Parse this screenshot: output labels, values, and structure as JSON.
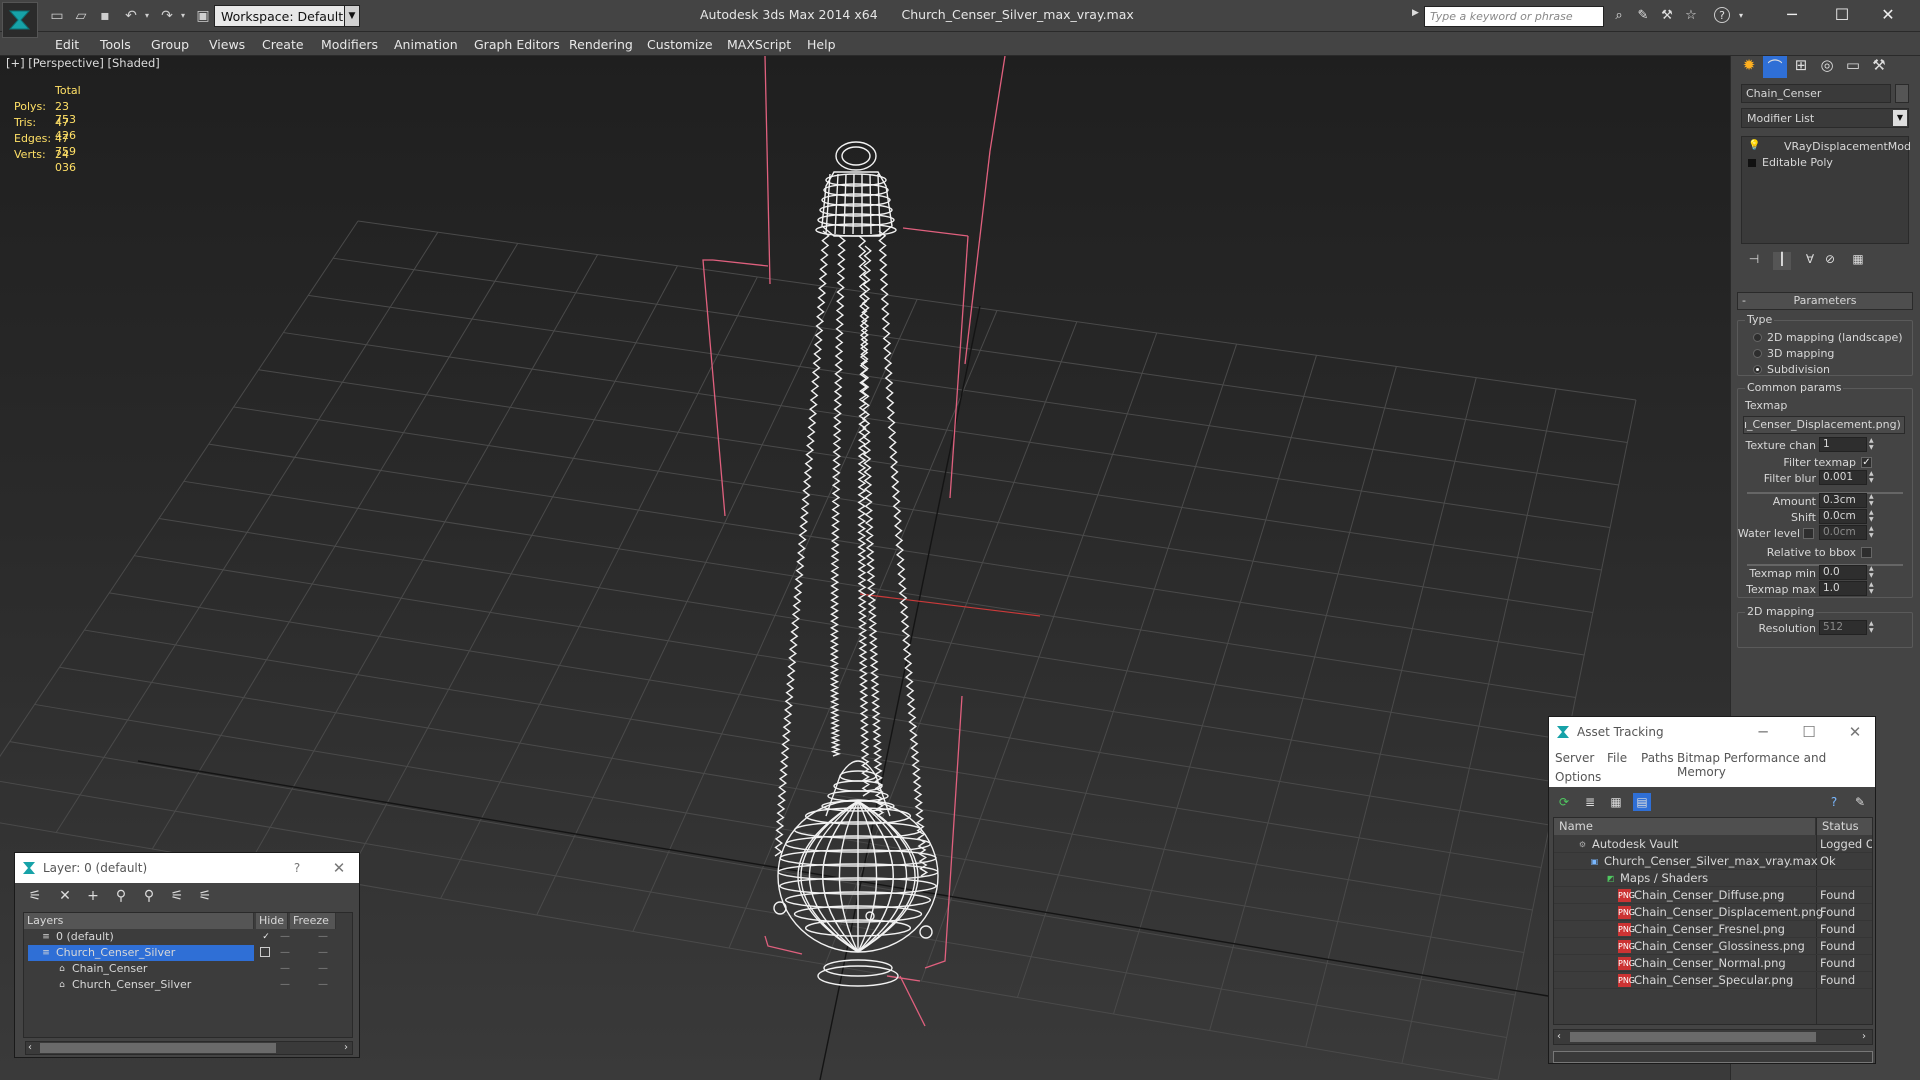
{
  "app": {
    "title": "Autodesk 3ds Max 2014 x64",
    "file": "Church_Censer_Silver_max_vray.max",
    "workspace": "Workspace: Default",
    "search_placeholder": "Type a keyword or phrase"
  },
  "menu": [
    "Edit",
    "Tools",
    "Group",
    "Views",
    "Create",
    "Modifiers",
    "Animation",
    "Graph Editors",
    "Rendering",
    "Customize",
    "MAXScript",
    "Help"
  ],
  "viewport": {
    "label": "[+] [Perspective] [Shaded]",
    "stats": {
      "header": "Total",
      "rows": [
        {
          "label": "Polys:",
          "value": "23 753"
        },
        {
          "label": "Tris:",
          "value": "47 426"
        },
        {
          "label": "Edges:",
          "value": "47 759"
        },
        {
          "label": "Verts:",
          "value": "24 036"
        }
      ]
    }
  },
  "command_panel": {
    "object_name": "Chain_Censer",
    "modifier_list": "Modifier List",
    "stack": [
      "VRayDisplacementMod",
      "Editable Poly"
    ],
    "rollout_title": "Parameters",
    "type_group": "Type",
    "type_options": [
      "2D mapping (landscape)",
      "3D mapping",
      "Subdivision"
    ],
    "type_selected": 2,
    "common_group": "Common params",
    "texmap_label": "Texmap",
    "texmap_value": "ı_Censer_Displacement.png)",
    "fields": [
      {
        "label": "Texture chan",
        "value": "1"
      },
      {
        "label": "Filter texmap",
        "checked": true
      },
      {
        "label": "Filter blur",
        "value": "0.001"
      },
      {
        "label": "Amount",
        "value": "0.3cm"
      },
      {
        "label": "Shift",
        "value": "0.0cm"
      },
      {
        "label": "Water level",
        "value": "0.0cm"
      },
      {
        "label": "Relative to bbox",
        "checked": false
      },
      {
        "label": "Texmap min",
        "value": "0.0"
      },
      {
        "label": "Texmap max",
        "value": "1.0"
      }
    ],
    "mapping_group": "2D mapping",
    "resolution_label": "Resolution",
    "resolution_value": "512"
  },
  "layer_window": {
    "title": "Layer: 0 (default)",
    "help": "?",
    "columns": [
      "Layers",
      "Hide",
      "Freeze"
    ],
    "rows": [
      {
        "name": "0 (default)",
        "indent": 1,
        "selected": false
      },
      {
        "name": "Church_Censer_Silver",
        "indent": 1,
        "selected": true
      },
      {
        "name": "Chain_Censer",
        "indent": 2,
        "selected": false
      },
      {
        "name": "Church_Censer_Silver",
        "indent": 2,
        "selected": false
      }
    ]
  },
  "asset_window": {
    "title": "Asset Tracking",
    "menus": [
      "Server",
      "File",
      "Paths",
      "Bitmap Performance and Memory",
      "Options"
    ],
    "columns": [
      "Name",
      "Status"
    ],
    "rows": [
      {
        "name": "Autodesk Vault",
        "status": "Logged O",
        "indent": 1,
        "icon": "vault-icon"
      },
      {
        "name": "Church_Censer_Silver_max_vray.max",
        "status": "Ok",
        "indent": 2,
        "icon": "max-file-icon"
      },
      {
        "name": "Maps / Shaders",
        "status": "",
        "indent": 3,
        "icon": "maps-icon"
      },
      {
        "name": "Chain_Censer_Diffuse.png",
        "status": "Found",
        "indent": 4,
        "icon": "png-icon"
      },
      {
        "name": "Chain_Censer_Displacement.png",
        "status": "Found",
        "indent": 4,
        "icon": "png-icon"
      },
      {
        "name": "Chain_Censer_Fresnel.png",
        "status": "Found",
        "indent": 4,
        "icon": "png-icon"
      },
      {
        "name": "Chain_Censer_Glossiness.png",
        "status": "Found",
        "indent": 4,
        "icon": "png-icon"
      },
      {
        "name": "Chain_Censer_Normal.png",
        "status": "Found",
        "indent": 4,
        "icon": "png-icon"
      },
      {
        "name": "Chain_Censer_Specular.png",
        "status": "Found",
        "indent": 4,
        "icon": "png-icon"
      }
    ]
  },
  "colors": {
    "ui_bg": "#444444",
    "stats_text": "#ffe066",
    "selection": "#2f6fd6",
    "wire": "#ffffff",
    "bbox": "#e0607e"
  }
}
